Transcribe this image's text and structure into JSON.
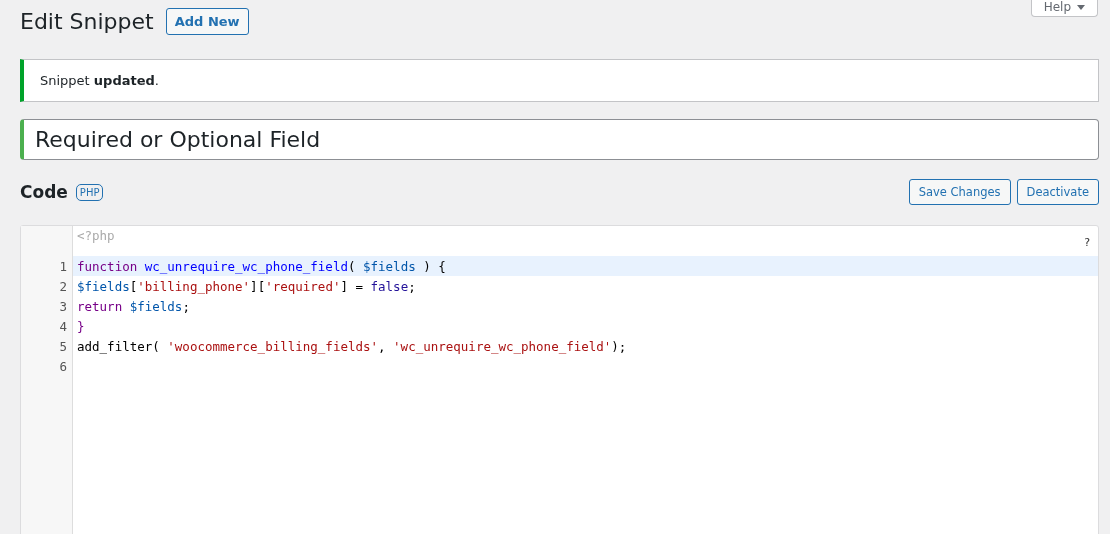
{
  "header": {
    "title": "Edit Snippet",
    "add_new": "Add New",
    "help": "Help"
  },
  "notice": {
    "text": "Snippet **updated**."
  },
  "snippet_title": {
    "value": "Required or Optional Field"
  },
  "code_section": {
    "heading": "Code",
    "language": "PHP",
    "buttons": [
      "Save Changes",
      "Deactivate"
    ]
  },
  "editor": {
    "opening_tag": "<?php",
    "help": "?",
    "lines": [
      {
        "number": "1",
        "active": true,
        "tokens": [
          {
            "kind": "keyword",
            "text": "function "
          },
          {
            "kind": "def",
            "text": "wc_unrequire_wc_phone_field"
          },
          {
            "kind": "plain",
            "text": "( "
          },
          {
            "kind": "variable",
            "text": "$fields"
          },
          {
            "kind": "plain",
            "text": " ) {"
          }
        ]
      },
      {
        "number": "2",
        "active": false,
        "tokens": [
          {
            "kind": "variable",
            "text": "$fields"
          },
          {
            "kind": "plain",
            "text": "["
          },
          {
            "kind": "string",
            "text": "'billing_phone'"
          },
          {
            "kind": "plain",
            "text": "]["
          },
          {
            "kind": "string",
            "text": "'required'"
          },
          {
            "kind": "plain",
            "text": "] = "
          },
          {
            "kind": "atom",
            "text": "false"
          },
          {
            "kind": "plain",
            "text": ";"
          }
        ]
      },
      {
        "number": "3",
        "active": false,
        "tokens": [
          {
            "kind": "keyword",
            "text": "return "
          },
          {
            "kind": "variable",
            "text": "$fields"
          },
          {
            "kind": "plain",
            "text": ";"
          }
        ]
      },
      {
        "number": "4",
        "active": false,
        "tokens": [
          {
            "kind": "keyword",
            "text": "}"
          }
        ]
      },
      {
        "number": "5",
        "active": false,
        "tokens": [
          {
            "kind": "plain",
            "text": "add_filter( "
          },
          {
            "kind": "string",
            "text": "'woocommerce_billing_fields'"
          },
          {
            "kind": "plain",
            "text": ", "
          },
          {
            "kind": "string",
            "text": "'wc_unrequire_wc_phone_field'"
          },
          {
            "kind": "plain",
            "text": ");"
          }
        ]
      },
      {
        "number": "6",
        "active": false
      }
    ]
  }
}
